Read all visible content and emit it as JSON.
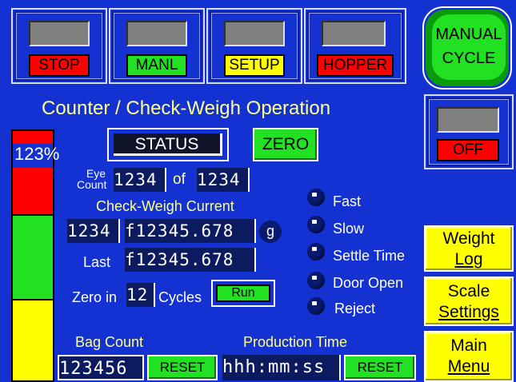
{
  "header": {
    "buttons": [
      {
        "label": "STOP"
      },
      {
        "label": "MANL"
      },
      {
        "label": "SETUP"
      },
      {
        "label": "HOPPER"
      }
    ],
    "manual_cycle": {
      "line1": "MANUAL",
      "line2": "CYCLE"
    }
  },
  "title": "Counter / Check-Weigh Operation",
  "level": {
    "percent_text": "123%"
  },
  "status_button": "STATUS",
  "zero_button": "ZERO",
  "off_indicator": {
    "label": "OFF"
  },
  "eye_count": {
    "label_line1": "Eye",
    "label_line2": "Count",
    "value": "1234",
    "of_label": "of",
    "total": "1234"
  },
  "checkweigh": {
    "label": "Check-Weigh Current",
    "count": "1234",
    "current_value": "f12345.678",
    "unit": "g",
    "last_label": "Last",
    "last_value": "f12345.678",
    "zero_in_label": "Zero in",
    "zero_cycles": "12",
    "cycles_label": "Cycles",
    "run_button": "Run"
  },
  "indicators": [
    {
      "label": "Fast"
    },
    {
      "label": "Slow"
    },
    {
      "label": "Settle Time"
    },
    {
      "label": "Door Open"
    },
    {
      "label": "Reject"
    }
  ],
  "side_buttons": {
    "weight_log": {
      "line1": "Weight",
      "line2": "Log"
    },
    "scale_settings": {
      "line1": "Scale",
      "line2": "Settings"
    },
    "main_menu": {
      "line1": "Main",
      "line2": "Menu"
    }
  },
  "bag_count": {
    "label": "Bag Count",
    "value": "123456",
    "reset_button": "RESET"
  },
  "production_time": {
    "label": "Production Time",
    "value": "hhh:mm:ss",
    "reset_button": "RESET"
  },
  "colors": {
    "background": "#1432d2",
    "text_yellow": "#ffff90",
    "stop_red": "#ff0000",
    "manl_green": "#22e022",
    "setup_yellow": "#ffff00"
  }
}
